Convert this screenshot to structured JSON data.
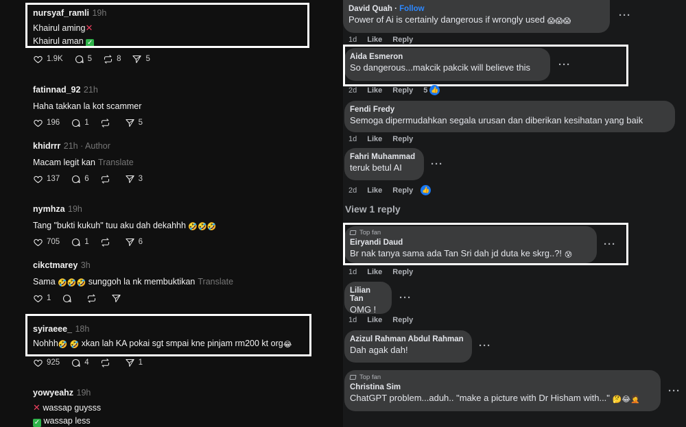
{
  "threads": {
    "posts": [
      {
        "user": "nursyaf_ramli",
        "time": "19h",
        "lines": [
          "Khairul aming",
          "Khairul aman"
        ],
        "likes": "1.9K",
        "replies": "5",
        "reposts": "8",
        "shares": "5"
      },
      {
        "user": "fatinnad_92",
        "time": "21h",
        "text": "Haha takkan la kot scammer",
        "likes": "196",
        "replies": "1",
        "reposts": "",
        "shares": "5"
      },
      {
        "user": "khidrrr",
        "time": "21h · Author",
        "text": "Macam legit kan",
        "translate": "Translate",
        "likes": "137",
        "replies": "6",
        "reposts": "",
        "shares": "3"
      },
      {
        "user": "nymhza",
        "time": "19h",
        "text": "Tang \"bukti kukuh\" tuu aku dah dekahhh",
        "likes": "705",
        "replies": "1",
        "reposts": "",
        "shares": "6"
      },
      {
        "user": "cikctmarey",
        "time": "3h",
        "text": "Sama",
        "text2": "sunggoh la nk membuktikan",
        "translate": "Translate",
        "likes": "1",
        "replies": "",
        "reposts": "",
        "shares": ""
      },
      {
        "user": "syiraeee_",
        "time": "18h",
        "text": "Nohhh",
        "text2": "xkan lah KA pokai sgt smpai kne pinjam rm200 kt org",
        "likes": "925",
        "replies": "4",
        "reposts": "",
        "shares": "1"
      },
      {
        "user": "yowyeahz",
        "time": "19h",
        "lines": [
          "wassap guysss",
          "wassap less"
        ]
      }
    ]
  },
  "facebook": {
    "comments": [
      {
        "name": "David Quah",
        "follow": "Follow",
        "text": "Power of Ai is certainly dangerous if wrongly used",
        "age": "1d",
        "like": "Like",
        "reply": "Reply"
      },
      {
        "name": "Aida Esmeron",
        "text": "So dangerous...makcik pakcik will believe this",
        "age": "2d",
        "like": "Like",
        "reply": "Reply",
        "reactions": "5"
      },
      {
        "name": "Fendi Fredy",
        "text": "Semoga dipermudahkan segala urusan dan diberikan kesihatan yang baik",
        "age": "1d",
        "like": "Like",
        "reply": "Reply"
      },
      {
        "name": "Fahri Muhammad",
        "text": "teruk betul AI",
        "age": "2d",
        "like": "Like",
        "reply": "Reply"
      },
      {
        "badge": "Top fan",
        "name": "Eiryandi Daud",
        "text": "Br nak tanya sama ada Tan Sri dah jd duta ke skrg..?!",
        "age": "1d",
        "like": "Like",
        "reply": "Reply"
      },
      {
        "name": "Lilian Tan",
        "text": "OMG !",
        "age": "1d",
        "like": "Like",
        "reply": "Reply"
      },
      {
        "name": "Azizul Rahman Abdul Rahman",
        "text": "Dah agak dah!"
      },
      {
        "badge": "Top fan",
        "name": "Christina Sim",
        "text": "ChatGPT problem...aduh.. \"make a picture with Dr Hisham with...\""
      }
    ],
    "view_reply": "View 1 reply"
  },
  "colors": {
    "threads_bg": "#101010",
    "facebook_bg": "#18191a",
    "bubble": "#3a3b3c",
    "link_blue": "#2d88ff",
    "highlight_border": "#ffffff"
  }
}
